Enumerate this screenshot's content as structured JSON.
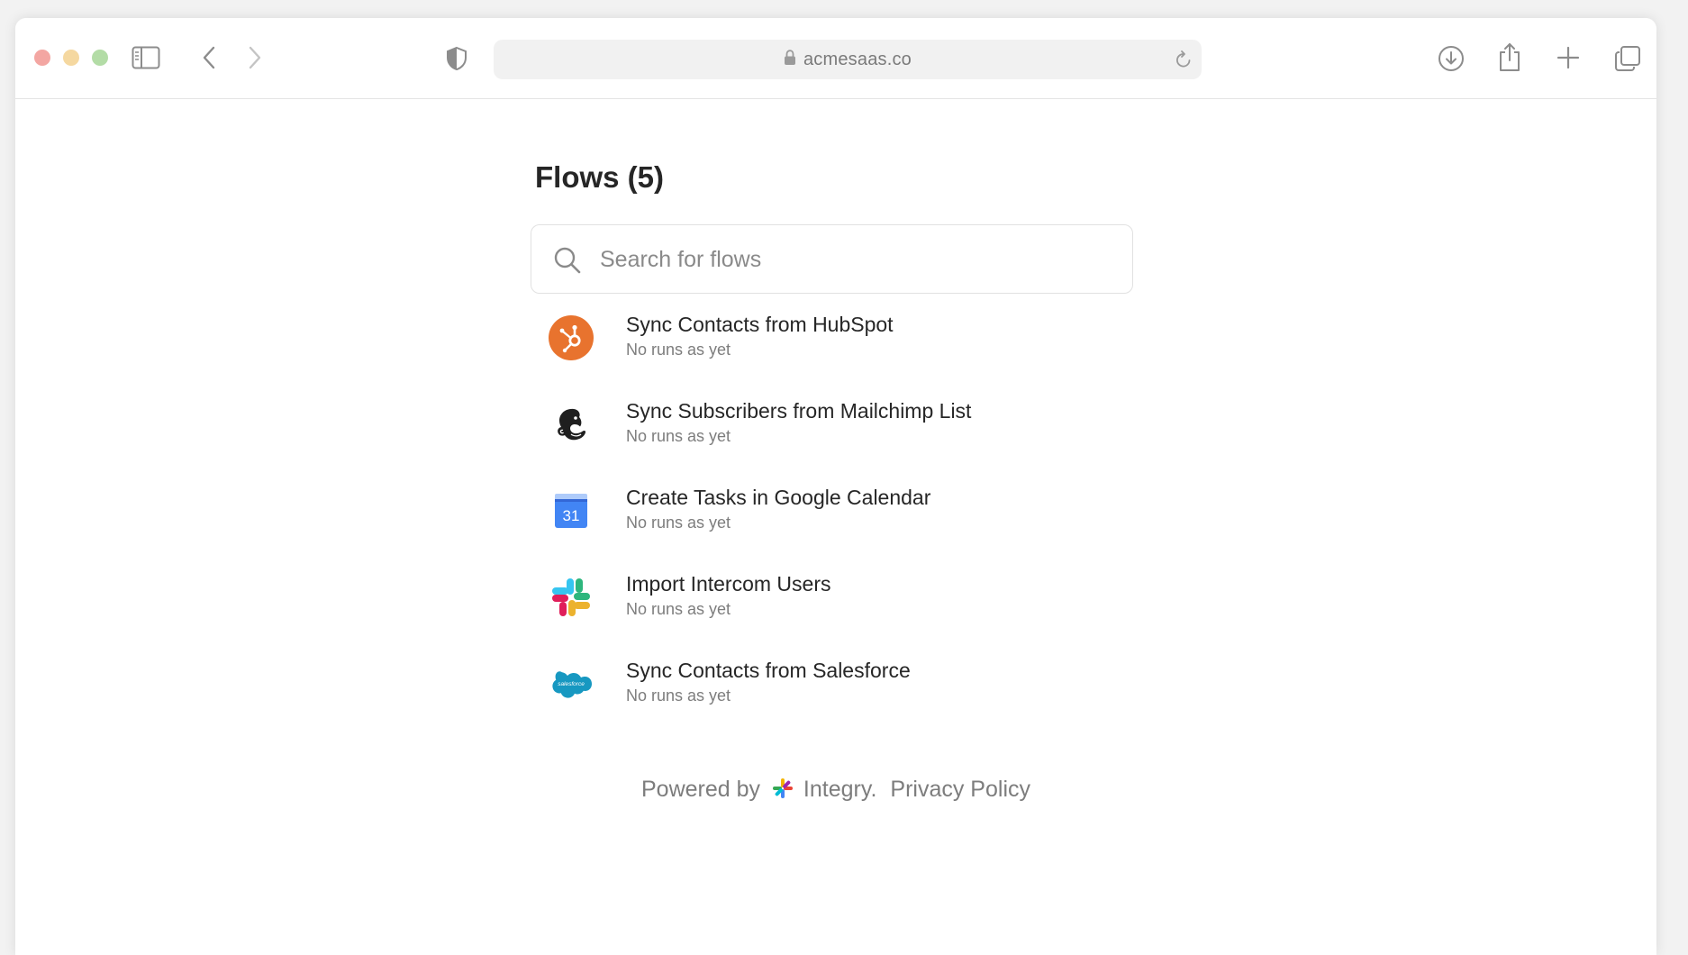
{
  "browser": {
    "url": "acmesaas.co"
  },
  "page": {
    "title": "Flows (5)",
    "search": {
      "placeholder": "Search for flows",
      "value": ""
    },
    "flows": [
      {
        "name": "Sync Contacts from HubSpot",
        "status": "No runs as yet",
        "icon": "hubspot-icon"
      },
      {
        "name": "Sync Subscribers from Mailchimp List",
        "status": "No runs as yet",
        "icon": "mailchimp-icon"
      },
      {
        "name": "Create Tasks in Google Calendar",
        "status": "No runs as yet",
        "icon": "google-calendar-icon",
        "icon_text": "31"
      },
      {
        "name": "Import Intercom Users",
        "status": "No runs as yet",
        "icon": "slack-icon"
      },
      {
        "name": "Sync Contacts from Salesforce",
        "status": "No runs as yet",
        "icon": "salesforce-icon",
        "icon_text": "salesforce"
      }
    ],
    "footer": {
      "powered_by": "Powered by",
      "brand": "Integry.",
      "privacy": "Privacy Policy"
    }
  },
  "colors": {
    "hubspot": "#e8732e",
    "calendar_blue": "#4285f4",
    "salesforce": "#1798c1"
  }
}
